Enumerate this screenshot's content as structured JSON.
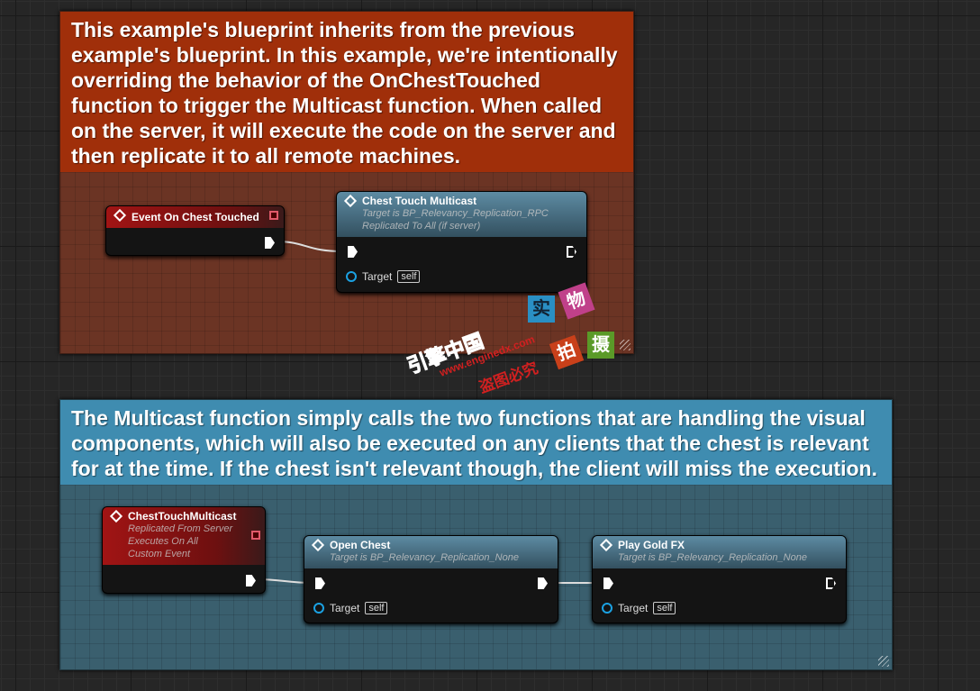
{
  "comments": [
    {
      "text": "This example's blueprint inherits from the previous example's blueprint. In this example, we're intentionally overriding the behavior of the OnChestTouched function to trigger the Multicast function. When called on the server, it will execute the code on the server and then replicate it to all remote machines.",
      "color": "#a02f0a"
    },
    {
      "text": "The Multicast function simply calls the two functions that are handling the visual components, which will also be executed on any clients that the chest is relevant for at the time. If the chest isn't relevant though, the client will miss the execution.",
      "color": "#3f8cb0"
    }
  ],
  "nodes": {
    "event": {
      "title": "Event On Chest Touched"
    },
    "multicast": {
      "title": "Chest Touch Multicast",
      "sub1": "Target is BP_Relevancy_Replication_RPC",
      "sub2": "Replicated To All (if server)",
      "pin": "Target",
      "self": "self"
    },
    "custom": {
      "title": "ChestTouchMulticast",
      "sub1": "Replicated From Server",
      "sub2": "Executes On All",
      "sub3": "Custom Event"
    },
    "open": {
      "title": "Open Chest",
      "sub1": "Target is BP_Relevancy_Replication_None",
      "pin": "Target",
      "self": "self"
    },
    "gold": {
      "title": "Play Gold FX",
      "sub1": "Target is BP_Relevancy_Replication_None",
      "pin": "Target",
      "self": "self"
    }
  },
  "watermark": {
    "chars": [
      "实",
      "物",
      "拍",
      "摄"
    ],
    "site": "引擎中国",
    "url": "www.enginedx.com",
    "notice": "盗图必究"
  }
}
